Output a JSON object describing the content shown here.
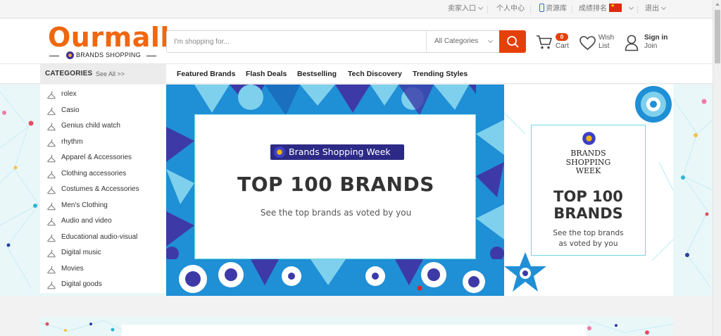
{
  "topbar": {
    "seller_entry": "卖家入口",
    "personal_center": "个人中心",
    "resource_library": "资源库",
    "ranking": "成绩排名",
    "logout": "退出"
  },
  "logo": {
    "name": "Ourmall",
    "tagline": "BRANDS SHOPPING"
  },
  "search": {
    "placeholder": "I'm shopping for...",
    "category": "All Categories"
  },
  "header_actions": {
    "cart_count": "0",
    "cart_label": "Cart",
    "wish_line1": "Wish",
    "wish_line2": "List",
    "sign_in": "Sign in",
    "join": "Join"
  },
  "categories": {
    "title": "CATEGORIES",
    "see_all": "See All >>",
    "items": [
      "rolex",
      "Casio",
      "Genius child watch",
      "rhythm",
      "Apparel & Accessories",
      "Clothing accessories",
      "Costumes & Accessories",
      "Men's Clothing",
      "Audio and video",
      "Educational audio-visual",
      "Digital music",
      "Movies",
      "Digital goods"
    ]
  },
  "nav": {
    "links": [
      "Featured Brands",
      "Flash Deals",
      "Bestselling",
      "Tech Discovery",
      "Trending Styles"
    ]
  },
  "banner": {
    "pill": "Brands Shopping Week",
    "title": "TOP 100 BRANDS",
    "subtitle": "See the top brands as voted by you"
  },
  "right_ad": {
    "bsw_line1": "BRANDS",
    "bsw_line2": "SHOPPING",
    "bsw_line3": "WEEK",
    "top_line1": "TOP 100",
    "top_line2": "BRANDS",
    "sub_line1": "See the top brands",
    "sub_line2": "as voted by you"
  },
  "colors": {
    "brand_orange": "#f0670f",
    "search_button": "#e6400a",
    "navy": "#2c2a86",
    "pattern_blue": "#1f8fd6",
    "pattern_light": "#7fd0ec",
    "pattern_indigo": "#3d3aa8",
    "mint_bg": "#eaf7f9"
  },
  "icons": {
    "search_button": "search-icon",
    "cart": "cart-icon",
    "wish": "heart-icon",
    "account": "user-icon",
    "category_item": "hanger-icon",
    "phone": "phone-icon",
    "flag": "flag-icon"
  }
}
